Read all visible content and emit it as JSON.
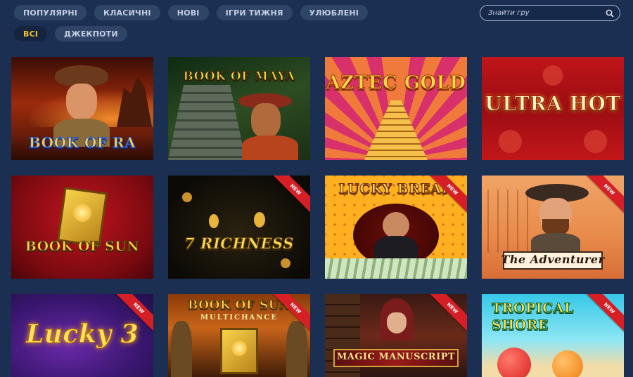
{
  "tabs": [
    {
      "label": "ПОПУЛЯРНІ",
      "active": false
    },
    {
      "label": "КЛАСИЧНІ",
      "active": false
    },
    {
      "label": "НОВІ",
      "active": false
    },
    {
      "label": "ІГРИ ТИЖНЯ",
      "active": false
    },
    {
      "label": "УЛЮБЛЕНІ",
      "active": false
    },
    {
      "label": "ВСІ",
      "active": true
    },
    {
      "label": "ДЖЕКПОТИ",
      "active": false
    }
  ],
  "search": {
    "placeholder": "Знайти гру",
    "icon": "search-icon"
  },
  "badge_label": "NEW",
  "games": [
    {
      "title": "BOOK OF RA",
      "is_new": false
    },
    {
      "title": "BOOK OF MAYA",
      "is_new": false
    },
    {
      "title": "AZTEC GOLD",
      "is_new": false
    },
    {
      "title": "ULTRA HOT",
      "is_new": false
    },
    {
      "title": "BOOK OF SUN",
      "is_new": false
    },
    {
      "title": "7 RICHNESS",
      "is_new": true
    },
    {
      "title": "LUCKY BREAK",
      "is_new": true
    },
    {
      "title": "The Adventurer",
      "is_new": true
    },
    {
      "title": "Lucky 3",
      "is_new": true
    },
    {
      "title": "BOOK OF SUN",
      "subtitle": "MULTICHANCE",
      "is_new": true
    },
    {
      "title": "MAGIC MANUSCRIPT",
      "is_new": true
    },
    {
      "title": "TROPICAL SHORE",
      "is_new": true
    }
  ],
  "colors": {
    "background": "#1b2f52",
    "tab": "#2f4467",
    "active_tab_text": "#f6c22c",
    "new_ribbon": "#d61f25"
  }
}
